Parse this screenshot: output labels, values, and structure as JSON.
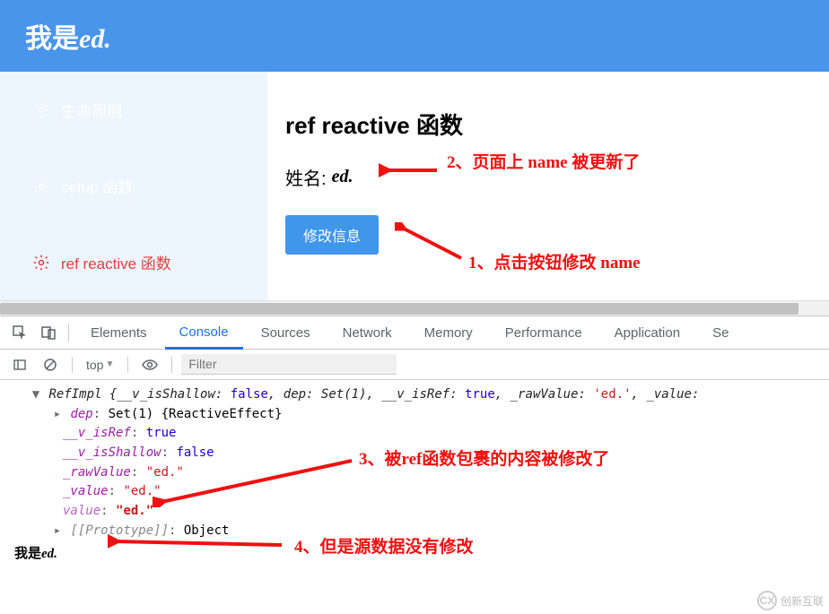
{
  "header": {
    "title_prefix": "我是",
    "title_italic": "ed."
  },
  "sidebar": {
    "items": [
      {
        "label": "生命周期",
        "active": false
      },
      {
        "label": "setup 函数",
        "active": false
      },
      {
        "label": "ref reactive 函数",
        "active": true
      }
    ]
  },
  "content": {
    "heading": "ref reactive 函数",
    "name_label": "姓名:",
    "name_value": "ed.",
    "button": "修改信息"
  },
  "annotations": {
    "a1": "1、点击按钮修改 name",
    "a2": "2、页面上 name 被更新了",
    "a3": "3、被ref函数包裹的内容被修改了",
    "a4": "4、但是源数据没有修改"
  },
  "devtools": {
    "tabs": [
      "Elements",
      "Console",
      "Sources",
      "Network",
      "Memory",
      "Performance",
      "Application",
      "Se"
    ],
    "active_tab": "Console",
    "context": "top",
    "filter_placeholder": "Filter"
  },
  "console": {
    "summary": {
      "type": "RefImpl",
      "open": "{__v_isShallow: ",
      "v1": "false",
      "sep1": ", dep: ",
      "dep": "Set(1)",
      "sep2": ", __v_isRef: ",
      "v2": "true",
      "sep3": ", _rawValue: ",
      "raw": "'ed.'",
      "sep4": ", _value:"
    },
    "props": {
      "dep_key": "dep",
      "dep_val": "Set(1) {ReactiveEffect}",
      "isRef_key": "__v_isRef",
      "isRef_val": "true",
      "isShallow_key": "__v_isShallow",
      "isShallow_val": "false",
      "raw_key": "_rawValue",
      "raw_val": "\"ed.\"",
      "val_key": "_value",
      "val_val": "\"ed.\"",
      "value_key": "value",
      "value_val": "\"ed.\"",
      "proto_key": "[[Prototype]]",
      "proto_val": "Object"
    },
    "final_prefix": "我是",
    "final_italic": "ed."
  },
  "watermark": {
    "brand": "CX",
    "text": "创新互联"
  },
  "colors": {
    "accent": "#4995ec",
    "danger": "#e63c3c",
    "annotation": "#e11b1b"
  }
}
